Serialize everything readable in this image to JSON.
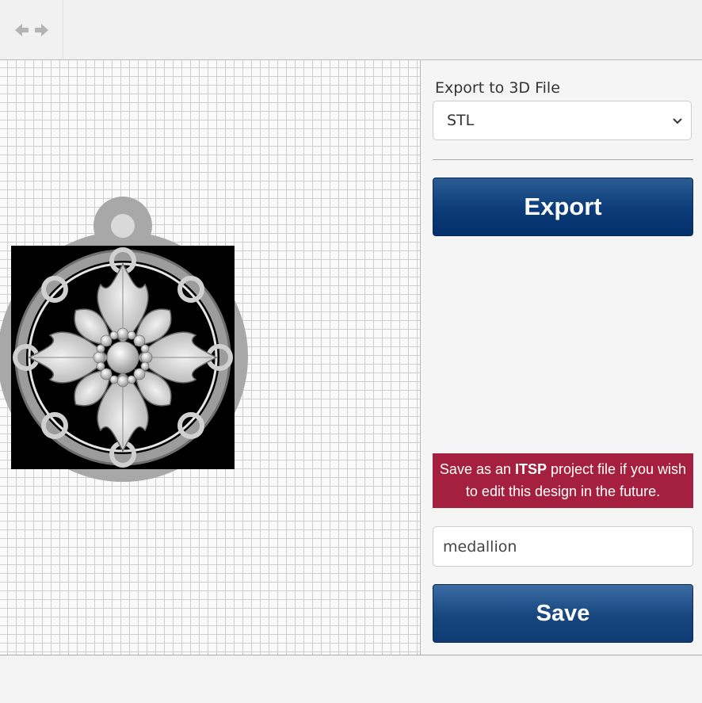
{
  "toolbar": {
    "nav_icon": "left-right-arrows-icon"
  },
  "export": {
    "label": "Export to 3D File",
    "format_selected": "STL",
    "button_label": "Export"
  },
  "save": {
    "notice_prefix": "Save as an ",
    "notice_bold": "ITSP",
    "notice_suffix": " project file if you wish to edit this design in the future.",
    "filename_value": "medallion",
    "button_label": "Save"
  },
  "colors": {
    "button_blue": "#0b3b78",
    "notice_red": "#a4203e",
    "medallion_gray": "#a8a8a8"
  }
}
